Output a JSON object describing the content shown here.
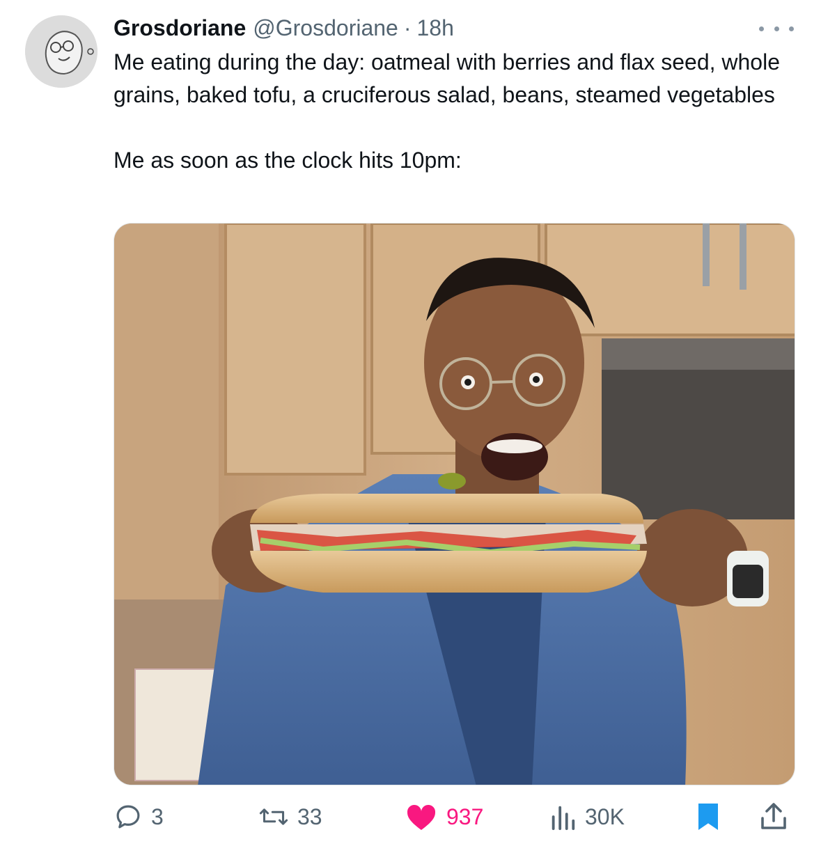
{
  "tweet": {
    "author_name": "Grosdoriane",
    "author_handle": "@Grosdoriane",
    "separator": "·",
    "time": "18h",
    "text_line_1": "Me eating during the day: oatmeal with berries and flax seed, whole grains, baked tofu, a cruciferous salad, beans, steamed vegetables",
    "text_line_2": "Me as soon as the clock hits 10pm:"
  },
  "actions": {
    "replies": "3",
    "reposts": "33",
    "likes": "937",
    "views": "30K"
  },
  "colors": {
    "text": "#0f1419",
    "secondary": "#536471",
    "like": "#f91880",
    "bookmark": "#1d9bf0"
  },
  "icons": [
    "avatar-sketch",
    "more-icon",
    "reply-icon",
    "repost-icon",
    "heart-icon",
    "views-icon",
    "bookmark-icon",
    "share-icon"
  ]
}
